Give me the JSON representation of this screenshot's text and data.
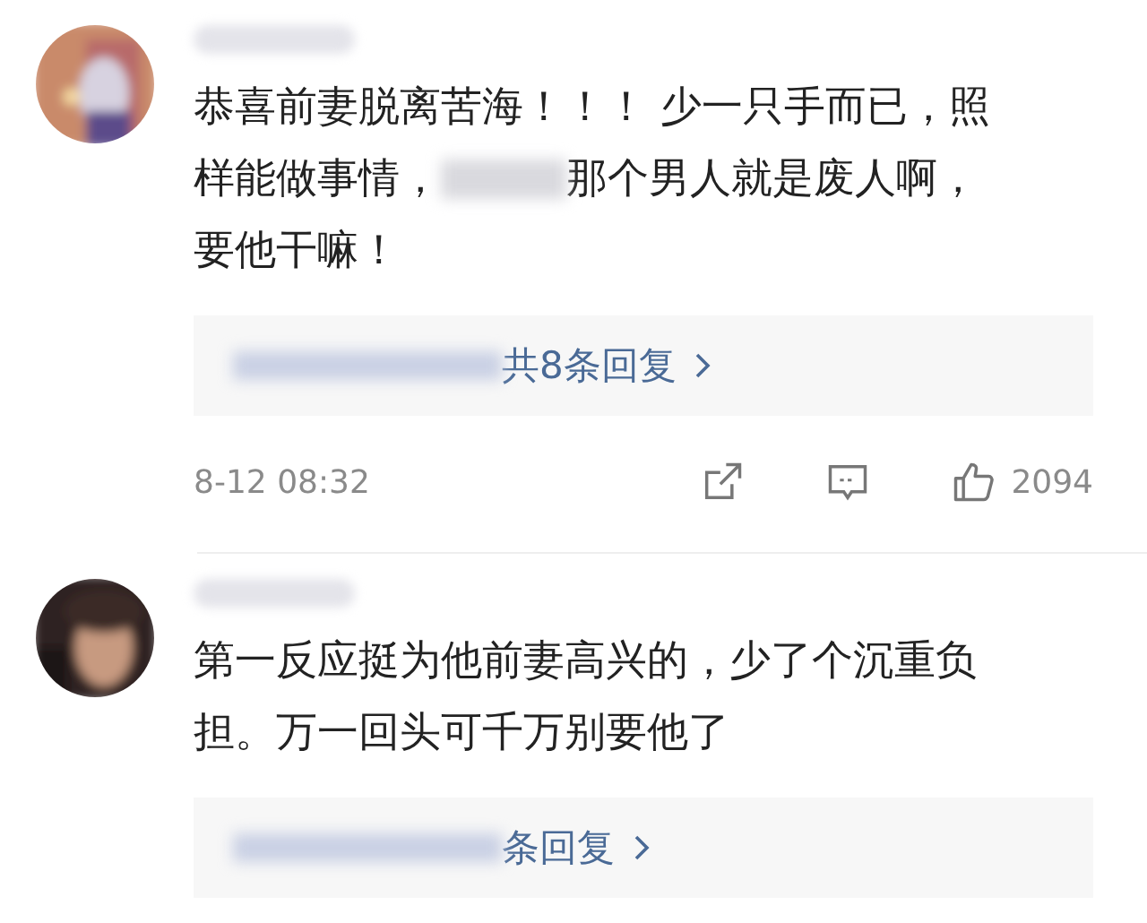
{
  "comments": [
    {
      "avatar": {
        "kind": "picture"
      },
      "body": [
        [
          {
            "kind": "text",
            "text": "恭喜前妻脱离苦海！！！ 少一只手而已，照"
          }
        ],
        [
          {
            "kind": "text",
            "text": "样能做事情，"
          },
          {
            "kind": "redacted"
          },
          {
            "kind": "text",
            "text": "那个男人就是废人啊，"
          }
        ],
        [
          {
            "kind": "text",
            "text": "要他干嘛！"
          }
        ]
      ],
      "replies": "共8条回复",
      "time": "8-12 08:32",
      "likes": "2094"
    },
    {
      "avatar": {
        "kind": "picture"
      },
      "body": [
        [
          {
            "kind": "text",
            "text": "第一反应挺为他前妻高兴的，少了个沉重负"
          }
        ],
        [
          {
            "kind": "text",
            "text": "担。万一回头可千万别要他了"
          }
        ]
      ],
      "replies": "条回复"
    }
  ]
}
